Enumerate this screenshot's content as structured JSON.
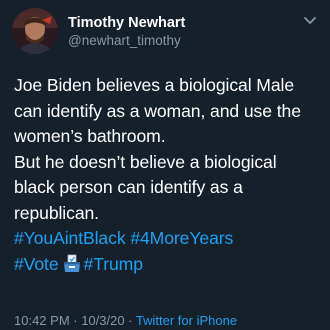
{
  "user": {
    "display_name": "Timothy Newhart",
    "handle": "@newhart_timothy"
  },
  "tweet": {
    "lines": [
      "Joe Biden believes a biological Male",
      "can identify as a woman, and use the",
      "women’s bathroom.",
      "But he doesn’t believe a biological",
      "black person can identify as a",
      "republican."
    ],
    "hashtags": {
      "tag1": "#YouAintBlack",
      "tag2": "#4MoreYears",
      "tag3": "#Vote",
      "tag4": "#Trump"
    }
  },
  "meta": {
    "timestamp": "10:42 PM · 10/3/20 · ",
    "source": "Twitter for iPhone"
  },
  "colors": {
    "background": "#15202b",
    "text": "#ffffff",
    "secondary": "#8899a6",
    "accent": "#1da1f2"
  },
  "icons": {
    "caret": "chevron-down-icon",
    "emoji": "ballot-box-icon"
  }
}
